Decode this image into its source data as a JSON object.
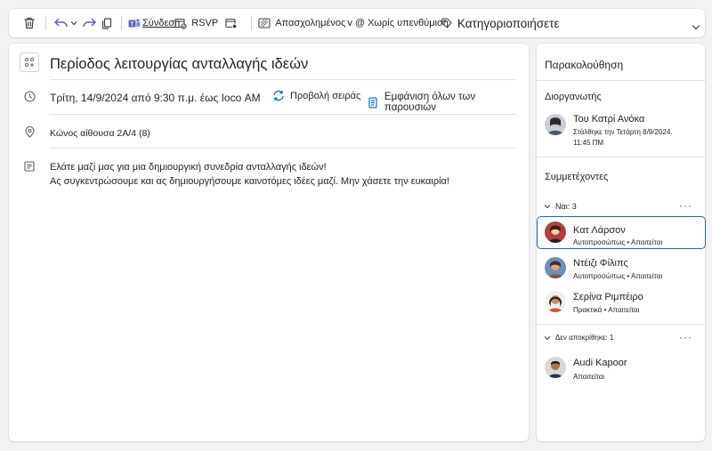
{
  "toolbar": {
    "join_label": "Σύνδεση",
    "rsvp_label": "RSVP",
    "busy_label": "Απασχολημένος",
    "no_reminder_label": "v @ Χωρίς υπενθύμιση",
    "categorize_label": "Κατηγοριοποιήσετε"
  },
  "event": {
    "title": "Περίοδος λειτουργίας ανταλλαγής ιδεών",
    "datetime": "Τρίτη, 14/9/2024 από 9:30 π.μ. έως Ιοco ΑΜ",
    "view_series_label": "Προβολή σειράς",
    "show_all_label": "Εμφάνιση όλων των παρουσιών",
    "location": "Κώνος αίθουσα 2A/4 (8)",
    "body_line1": "Ελάτε μαζί μας για μια δημιουργική συνεδρία ανταλλαγής ιδεών!",
    "body_line2": "Ας συγκεντρώσουμε και ας δημιουργήσουμε καινοτόμες ιδέες μαζί. Μην χάσετε την ευκαιρία!"
  },
  "tracking": {
    "title": "Παρακολούθηση",
    "organizer_label": "Διοργανωτής",
    "organizer": {
      "name": "Του Κατρί Ανόκα",
      "sent_line1": "Στάλθηκε την Τετάρτη 8/9/2024.",
      "sent_line2": "11:45 ΠΜ"
    },
    "attendees_label": "Συμμετέχοντες",
    "yes_group_label": "Ναι: 3",
    "no_response_group_label": "Δεν αποκρίθηκε: 1",
    "attendees": [
      {
        "name": "Κατ Λάρσον",
        "status": "Αυτοπροσώπως • Απαιτείται"
      },
      {
        "name": "Ντέιζι Φίλιπς",
        "status": "Αυτοπροσώπως • Απαιτείται"
      },
      {
        "name": "Σερίνα Ριμπέιρο",
        "status": "Πρακτικά • Απαιτείται"
      }
    ],
    "no_response": [
      {
        "name": "Audi Kapoor",
        "status": "Απαιτείται"
      }
    ]
  },
  "colors": {
    "accent": "#0f6cbd",
    "teams": "#5b5fc7",
    "background": "#f3f3f3"
  }
}
